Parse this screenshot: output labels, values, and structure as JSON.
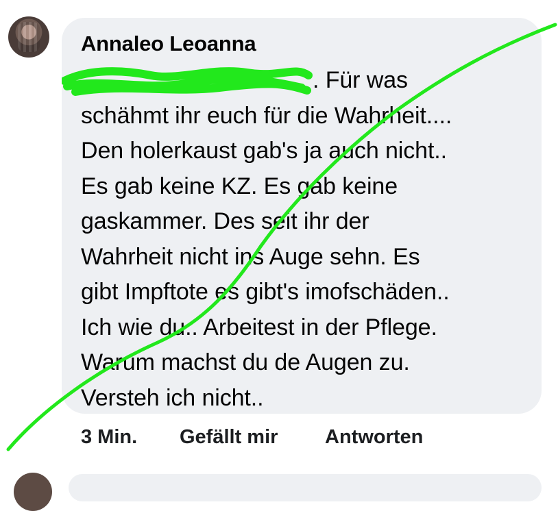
{
  "comment": {
    "author": "Annaleo Leoanna",
    "text_lines": [
      ". Für was",
      "schähmt ihr euch für die Wahrheit....",
      "Den holerkaust gab's ja auch nicht..",
      "Es gab keine KZ. Es gab keine",
      "gaskammer. Des seit ihr der",
      "Wahrheit nicht ins Auge sehn. Es",
      "gibt Impftote es gibt's imofschäden..",
      "Ich wie du.. Arbeitest in der Pflege.",
      "Warum machst du de Augen zu.",
      "Versteh ich nicht.."
    ],
    "timestamp": "3 Min.",
    "like_label": "Gefällt mir",
    "reply_label": "Antworten"
  },
  "colors": {
    "bubble": "#eef0f3",
    "highlighter": "#22e81c",
    "text": "#050505"
  },
  "icons": [
    "avatar",
    "redaction-scribble",
    "strike-line"
  ]
}
